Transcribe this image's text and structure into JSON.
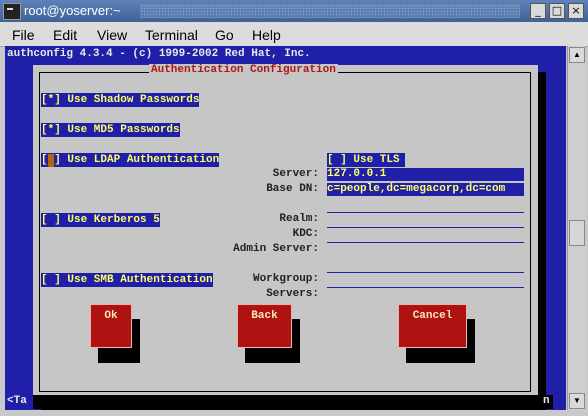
{
  "window": {
    "title": "root@yoserver:~",
    "controls": [
      "_",
      "□",
      "×"
    ]
  },
  "menubar": {
    "items": [
      "File",
      "Edit",
      "View",
      "Terminal",
      "Go",
      "Help"
    ]
  },
  "terminal": {
    "top_line": "authconfig 4.3.4 - (c) 1999-2002 Red Hat, Inc.",
    "bottom_left": "<Ta",
    "bottom_right": "n"
  },
  "dialog": {
    "title": "Authentication Configuration",
    "shadow_checkbox": "[*] Use Shadow Passwords",
    "md5_checkbox": "[*] Use MD5 Passwords",
    "ldap_checkbox": "[*] Use LDAP Authentication",
    "tls_checkbox": "[ ] Use TLS",
    "server_label": "Server:",
    "server_value": "127.0.0.1",
    "basedn_label": "Base DN:",
    "basedn_value": "c=people,dc=megacorp,dc=com",
    "kerberos_checkbox": "[ ] Use Kerberos 5",
    "realm_label": "Realm:",
    "kdc_label": "KDC:",
    "admin_server_label": "Admin Server:",
    "smb_checkbox": "[ ] Use SMB Authentication",
    "workgroup_label": "Workgroup:",
    "servers_label": "Servers:",
    "ok_label": "Ok",
    "back_label": "Back",
    "cancel_label": "Cancel"
  },
  "colors": {
    "terminal_bg": "#1f1fa8",
    "dialog_bg": "#c6c6c6",
    "highlight_text": "#ffff66",
    "button_bg": "#b01212",
    "title_text": "#b11616"
  }
}
